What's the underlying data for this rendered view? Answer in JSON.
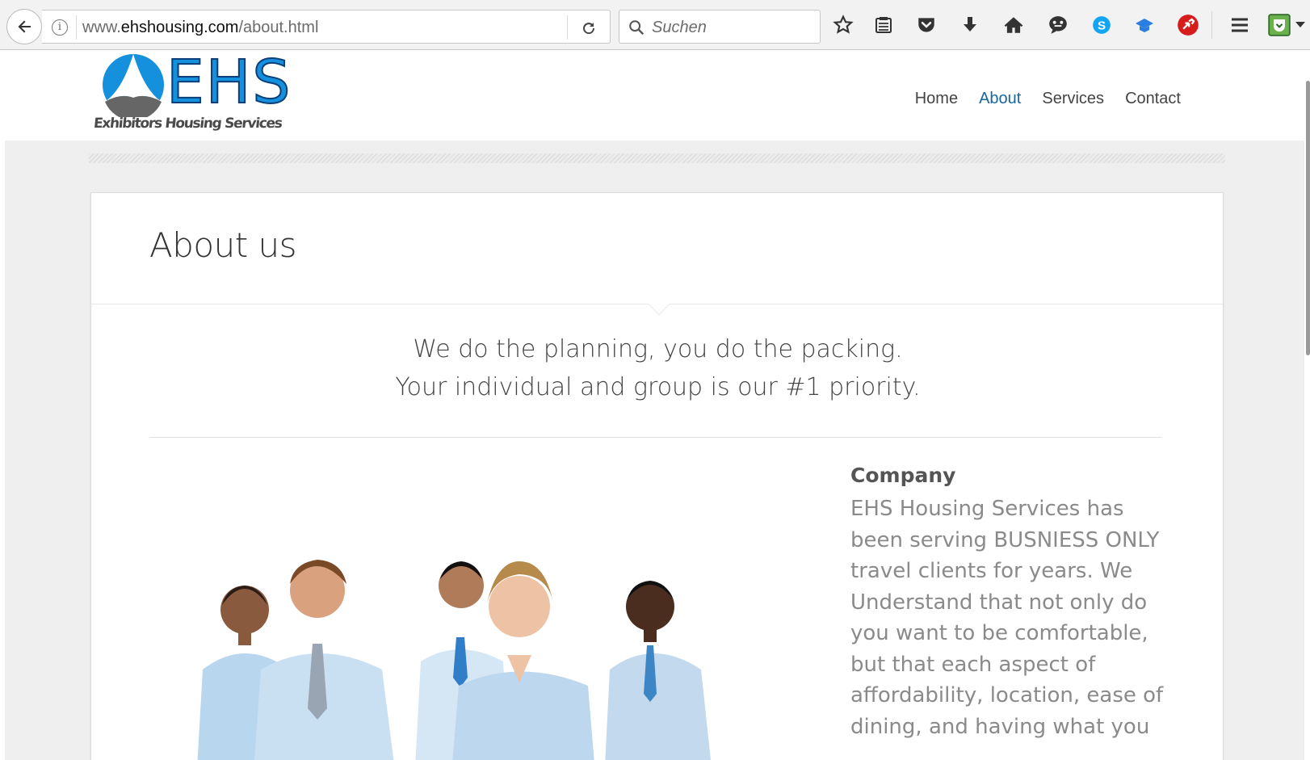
{
  "browser": {
    "url_prefix": "www.",
    "url_domain": "ehshousing.com",
    "url_path": "/about.html",
    "search_placeholder": "Suchen",
    "icons": [
      "back-icon",
      "info-icon",
      "reload-icon",
      "search-icon",
      "bookmark-star-icon",
      "reading-list-icon",
      "pocket-icon",
      "download-icon",
      "home-icon",
      "chat-icon",
      "skype-icon",
      "graduation-cap-icon",
      "red-addon-icon",
      "menu-icon",
      "green-addon-icon"
    ]
  },
  "site": {
    "logo_name": "EHS",
    "logo_tagline": "Exhibitors Housing Services",
    "brand_color": "#1590dc",
    "nav": [
      {
        "label": "Home",
        "active": false
      },
      {
        "label": "About",
        "active": true
      },
      {
        "label": "Services",
        "active": false
      },
      {
        "label": "Contact",
        "active": false
      }
    ]
  },
  "about": {
    "title": "About us",
    "tagline_line1": "We do the planning, you do the packing.",
    "tagline_line2": "Your individual and group is our #1 priority.",
    "company_heading": "Company",
    "company_text": "EHS Housing Services has been serving BUSNIESS ONLY travel clients for years. We Understand that not only do you want to be comfortable, but that each aspect of affordability, location, ease of dining, and having what you"
  }
}
